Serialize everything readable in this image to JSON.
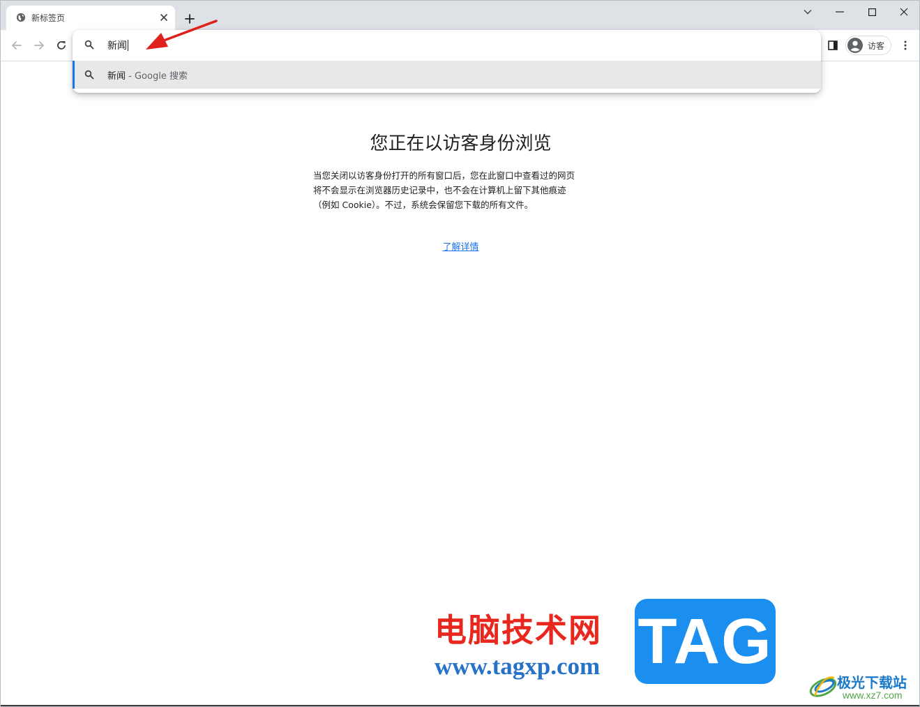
{
  "tab": {
    "title": "新标签页",
    "favicon": "globe-icon"
  },
  "window_controls": [
    "chevron-down-icon",
    "minimize-icon",
    "maximize-icon",
    "close-icon"
  ],
  "toolbar": {
    "profile_label": "访客"
  },
  "omnibox": {
    "input_value": "新闻",
    "suggestion": {
      "query": "新闻",
      "separator": " - ",
      "description": "Google 搜索"
    }
  },
  "content": {
    "title": "您正在以访客身份浏览",
    "description_lines": [
      "当您关闭以访客身份打开的所有窗口后，您在此窗口中查看过的网页",
      "将不会显示在浏览器历史记录中，也不会在计算机上留下其他痕迹",
      "（例如 Cookie）。不过，系统会保留您下载的所有文件。"
    ],
    "learn_more": "了解详情"
  },
  "watermark": {
    "site_name": "电脑技术网",
    "site_url": "www.tagxp.com",
    "tag_text": "TAG",
    "secondary_name": "极光下载站",
    "secondary_url": "www.xz7.com"
  },
  "colors": {
    "accent": "#1a73e8",
    "tabstrip_bg": "#dee1e6",
    "suggestion_bg": "#e8e8e9",
    "arrow": "#e0201b",
    "watermark_red": "#e8281f",
    "watermark_blue": "#1a8ff0"
  }
}
